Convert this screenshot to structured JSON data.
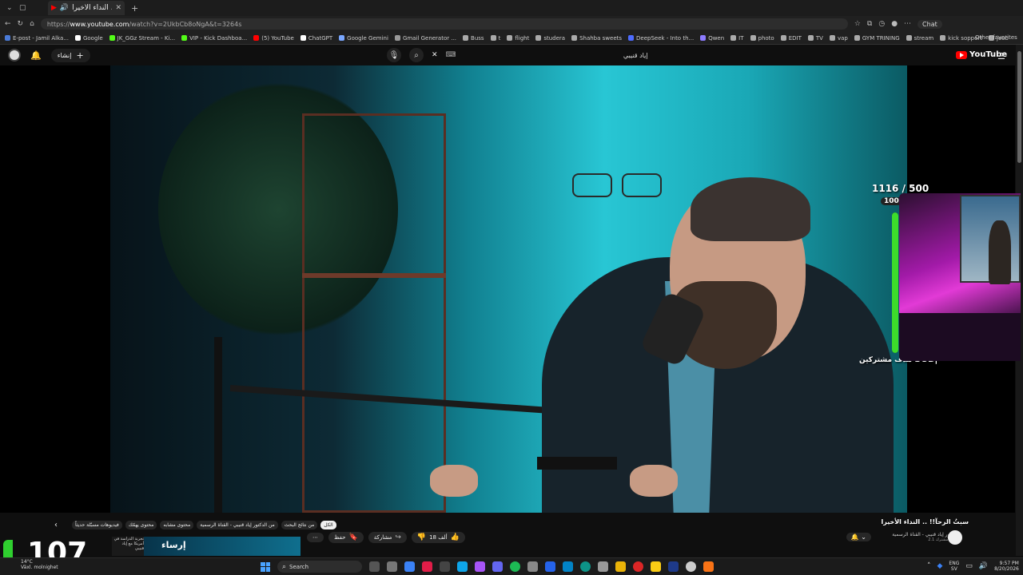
{
  "browser": {
    "tab_title": "سبتُ الرحآ!! .. النداء الأخيرا - YouTube",
    "url_prefix": "https://",
    "url_domain": "www.youtube.com",
    "url_path": "/watch?v=2UkbCb8oNgA&t=3264s",
    "chat_label": "Chat",
    "other_favorites": "Other favorites",
    "bookmarks": [
      {
        "label": "E-post - Jamil Alka...",
        "color": "#4a7bd8"
      },
      {
        "label": "Google",
        "color": "#ffffff"
      },
      {
        "label": "JK_GGz Stream - Ki...",
        "color": "#53fc18"
      },
      {
        "label": "VIP - Kick Dashboa...",
        "color": "#53fc18"
      },
      {
        "label": "(5) YouTube",
        "color": "#ff0000"
      },
      {
        "label": "ChatGPT",
        "color": "#ffffff"
      },
      {
        "label": "Google Gemini",
        "color": "#7aa7ff"
      },
      {
        "label": "Gmail Generator ...",
        "color": "#999999"
      },
      {
        "label": "Buss",
        "color": "#aaaaaa"
      },
      {
        "label": "t",
        "color": "#aaaaaa"
      },
      {
        "label": "flight",
        "color": "#aaaaaa"
      },
      {
        "label": "studera",
        "color": "#aaaaaa"
      },
      {
        "label": "Shahba sweets",
        "color": "#aaaaaa"
      },
      {
        "label": "DeepSeek - Into th...",
        "color": "#4d6bfe"
      },
      {
        "label": "Qwen",
        "color": "#8c7bff"
      },
      {
        "label": "IT",
        "color": "#aaaaaa"
      },
      {
        "label": "photo",
        "color": "#aaaaaa"
      },
      {
        "label": "EDIT",
        "color": "#aaaaaa"
      },
      {
        "label": "TV",
        "color": "#aaaaaa"
      },
      {
        "label": "vap",
        "color": "#aaaaaa"
      },
      {
        "label": "GYM TRINING",
        "color": "#aaaaaa"
      },
      {
        "label": "stream",
        "color": "#aaaaaa"
      },
      {
        "label": "kick sopport",
        "color": "#aaaaaa"
      },
      {
        "label": "joob",
        "color": "#aaaaaa"
      }
    ]
  },
  "youtube": {
    "create_label": "إنشاء",
    "search_query": "إياد قنيبي",
    "logo_text": "YouTube",
    "video_title": "سبتُ الرحآ!! .. النداء الأخيرا",
    "channel_name": "الدكتور إياد قنيبي - القناة الرسمية",
    "channel_subs": "2.1 مليون مشترك",
    "likes": "18 ألف",
    "share_label": "مشاركة",
    "save_label": "حفظ",
    "chips": [
      "الكل",
      "من نتائج البحث",
      "من الدكتور إياد قنيبي - القناة الرسمية",
      "محتوى مشابه",
      "محتوى يهمّك",
      "فيديوهات مسبّلة حديثاً"
    ],
    "rec_title": "تجربة الدراسة في أمريكا مع إياد قنيبي",
    "rec_meta": "إياد",
    "rec_thumb_text": "إرساء"
  },
  "overlay": {
    "sub_count": "1116 / 500",
    "sub_percent": "100%",
    "goal_fraction": 1.0,
    "goal_label": "هدف مشتركين",
    "goal_sub": "SUB|",
    "counter_value": "107",
    "accent_color": "#3ddc2b"
  },
  "taskbar": {
    "search_label": "Search",
    "weather_temp": "14°C",
    "weather_desc": "Växl. molnighet",
    "lang": "ENG",
    "lang_sub": "SV",
    "time": "9:57 PM",
    "date": "8/20/2026"
  }
}
